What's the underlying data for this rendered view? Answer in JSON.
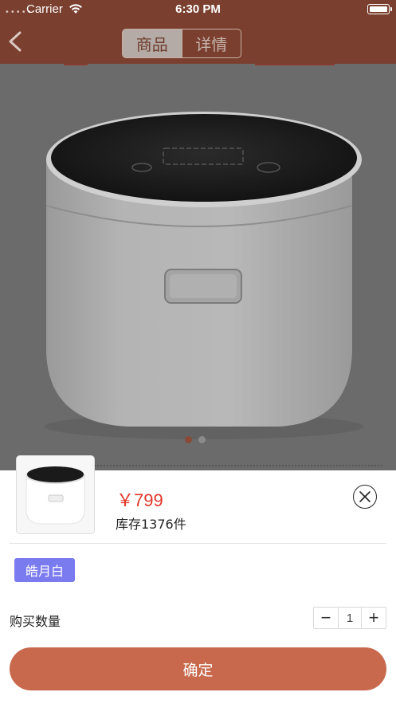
{
  "status_bar": {
    "carrier": "Carrier",
    "time": "6:30 PM",
    "signal_dots": "•••••"
  },
  "nav": {
    "tabs": [
      {
        "label": "商品",
        "active": true
      },
      {
        "label": "详情",
        "active": false
      }
    ],
    "icon": "back-chevron-icon"
  },
  "gallery": {
    "page_count": 2,
    "current_page": 1
  },
  "sheet": {
    "price": "￥799",
    "stock": "库存1376件",
    "spec_option": "皓月白",
    "quantity_label": "购买数量",
    "quantity": "1",
    "decrement": "−",
    "increment": "+",
    "confirm_label": "确定"
  },
  "colors": {
    "nav_bg": "#7a3f2e",
    "price": "#e1382b",
    "spec_chip": "#7b7bf0",
    "confirm_button": "#c8694d"
  }
}
